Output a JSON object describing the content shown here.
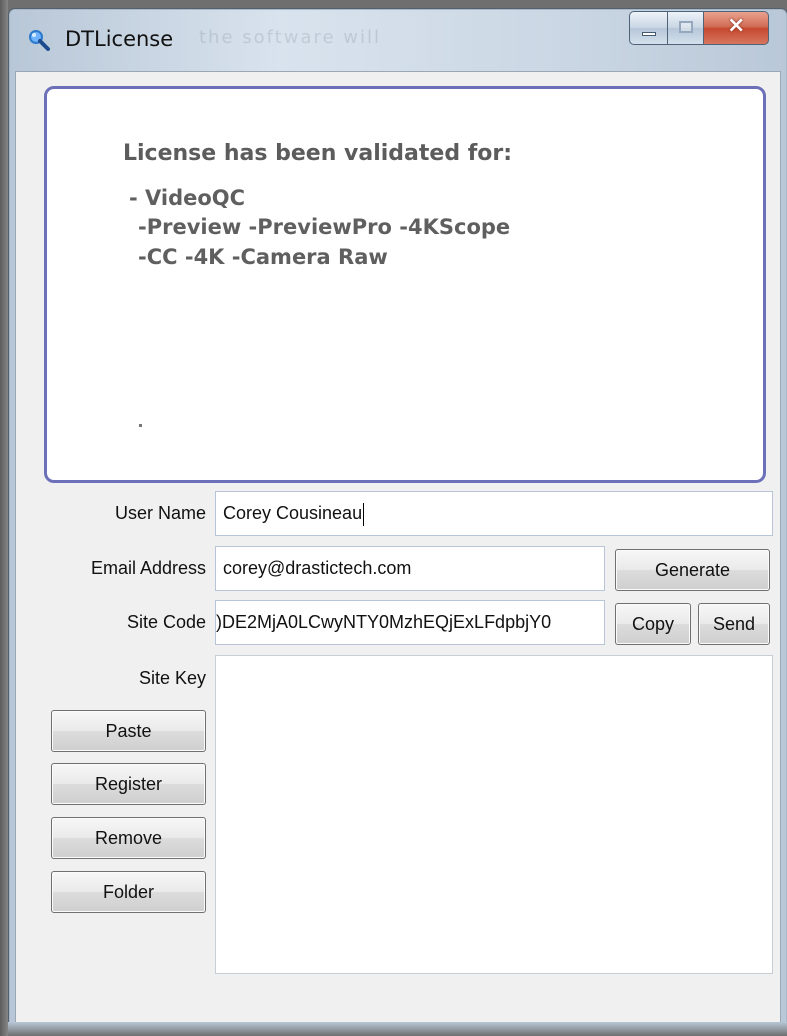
{
  "window": {
    "title": "DTLicense",
    "title_background_text": "the software will"
  },
  "license_panel": {
    "heading": "License has been validated for:",
    "lines": [
      "- VideoQC",
      "-Preview -PreviewPro -4KScope",
      "-CC -4K -Camera Raw"
    ],
    "dot": "."
  },
  "form": {
    "user_name_label": "User Name",
    "user_name_value": "Corey Cousineau",
    "email_label": "Email Address",
    "email_value": "corey@drastictech.com",
    "site_code_label": "Site Code",
    "site_code_value": ")DE2MjA0LCwyNTY0MzhEQjExLFdpbjY0",
    "site_key_label": "Site Key",
    "site_key_value": ""
  },
  "buttons": {
    "generate": "Generate",
    "copy": "Copy",
    "send": "Send",
    "paste": "Paste",
    "register": "Register",
    "remove": "Remove",
    "folder": "Folder"
  },
  "window_controls": {
    "minimize": "minimize",
    "maximize": "maximize",
    "close": "close"
  },
  "icons": {
    "app": "magnifier-icon",
    "minimize": "minimize-icon",
    "maximize": "maximize-icon",
    "close": "close-icon"
  },
  "colors": {
    "panel_border": "#6b70b8",
    "window_frame": "#cbd7e4",
    "close_button": "#c64930"
  }
}
